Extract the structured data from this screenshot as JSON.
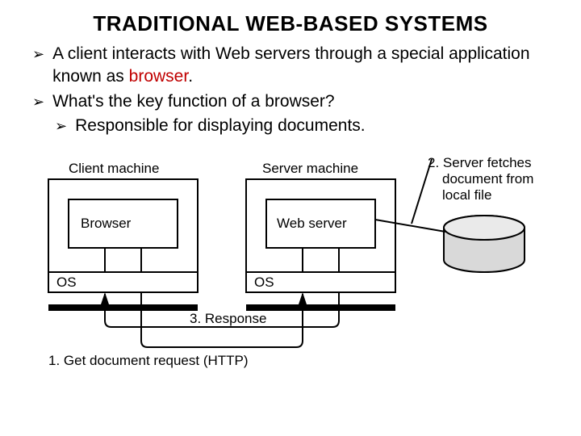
{
  "title": "TRADITIONAL WEB-BASED SYSTEMS",
  "bullets": {
    "b1_pre": "A client interacts with Web servers through a special application known as ",
    "b1_red": "browser",
    "b1_post": ".",
    "b2": "What's the key function of a browser?",
    "b2_sub": "Responsible for displaying documents."
  },
  "diagram": {
    "client_label": "Client machine",
    "server_label": "Server machine",
    "browser": "Browser",
    "webserver": "Web server",
    "os1": "OS",
    "os2": "OS",
    "step1": "1. Get document request (HTTP)",
    "step2a": "2. Server fetches",
    "step2b": "document from",
    "step2c": "local file",
    "step3": "3. Response"
  }
}
